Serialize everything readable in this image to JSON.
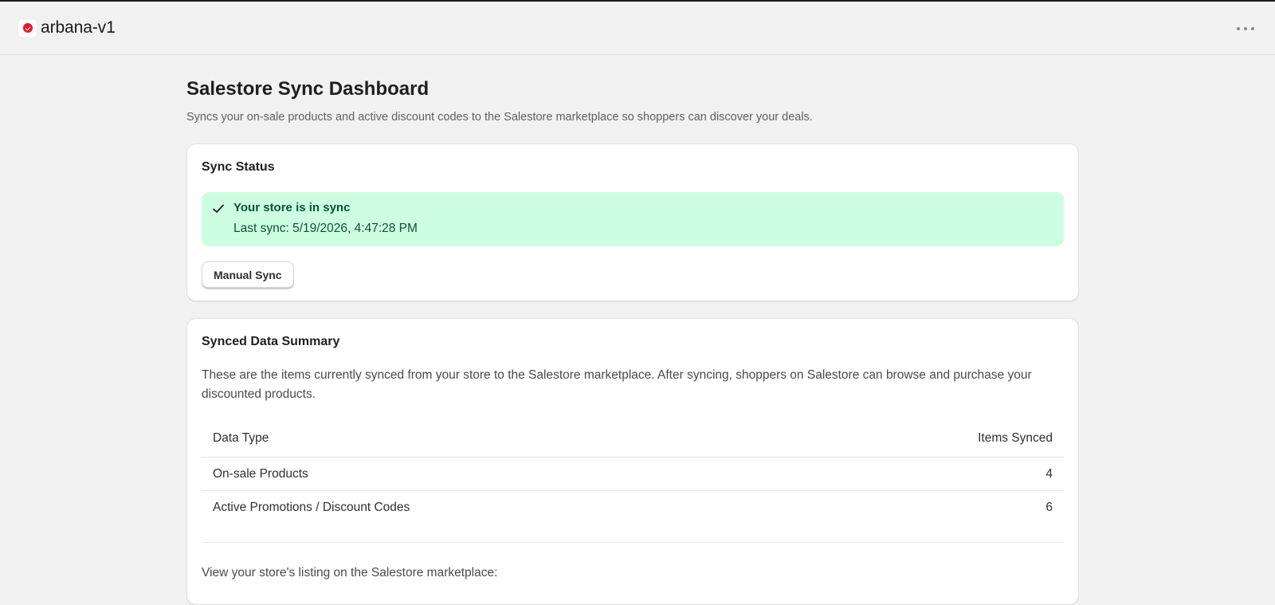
{
  "app": {
    "title": "arbana-v1",
    "more_icon": "ellipsis-horizontal-icon",
    "logo_icon": "app-logo-icon",
    "logo_color": "#e8192c"
  },
  "page": {
    "title": "Salestore Sync Dashboard",
    "subtitle": "Syncs your on-sale products and active discount codes to the Salestore marketplace so shoppers can discover your deals."
  },
  "sync_status": {
    "heading": "Sync Status",
    "banner": {
      "icon": "checkmark-icon",
      "title": "Your store is in sync",
      "text": "Last sync: 5/19/2026, 4:47:28 PM",
      "bg_color": "#cdfee1",
      "text_color": "#0c5132"
    },
    "manual_sync_label": "Manual Sync"
  },
  "summary": {
    "heading": "Synced Data Summary",
    "description": "These are the items currently synced from your store to the Salestore marketplace. After syncing, shoppers on Salestore can browse and purchase your discounted products.",
    "table": {
      "headers": [
        "Data Type",
        "Items Synced"
      ],
      "rows": [
        {
          "type": "On-sale Products",
          "count": "4"
        },
        {
          "type": "Active Promotions / Discount Codes",
          "count": "6"
        }
      ]
    },
    "footer_text": "View your store's listing on the Salestore marketplace:"
  }
}
